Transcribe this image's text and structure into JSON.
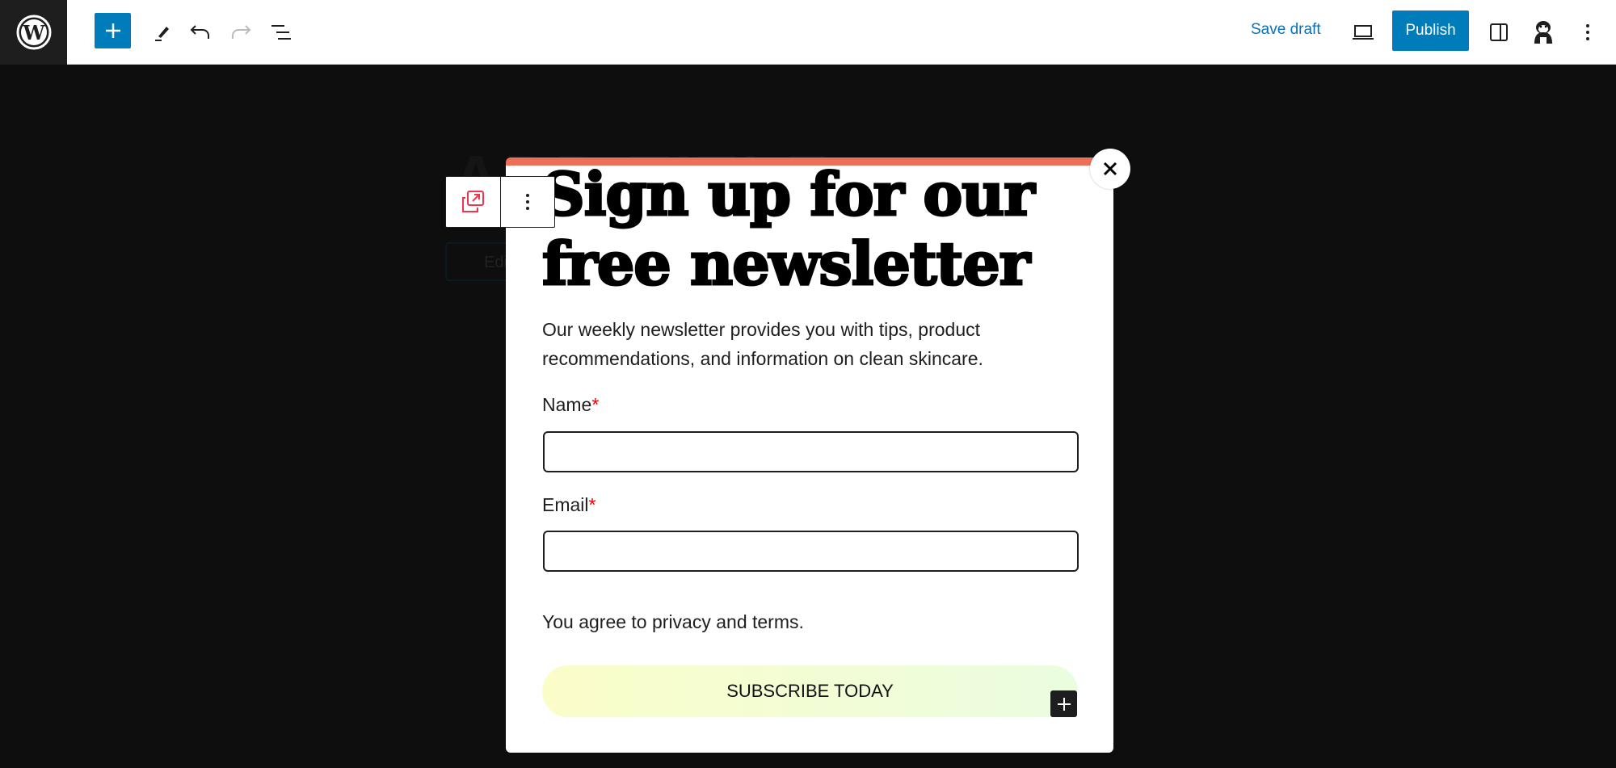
{
  "toolbar": {
    "save_draft": "Save draft",
    "publish": "Publish"
  },
  "background": {
    "title_placeholder": "ADD TITLE",
    "edit_button": "Edit"
  },
  "popup": {
    "accent_color": "#ee6f57",
    "heading": "Sign up for our free newsletter",
    "description": "Our weekly newsletter provides you with tips, product recommendations, and information on clean skincare.",
    "name_label": "Name",
    "email_label": "Email",
    "required_mark": "*",
    "name_value": "",
    "email_value": "",
    "agree_text": "You agree to privacy and terms.",
    "subscribe_button": "SUBSCRIBE TODAY"
  }
}
